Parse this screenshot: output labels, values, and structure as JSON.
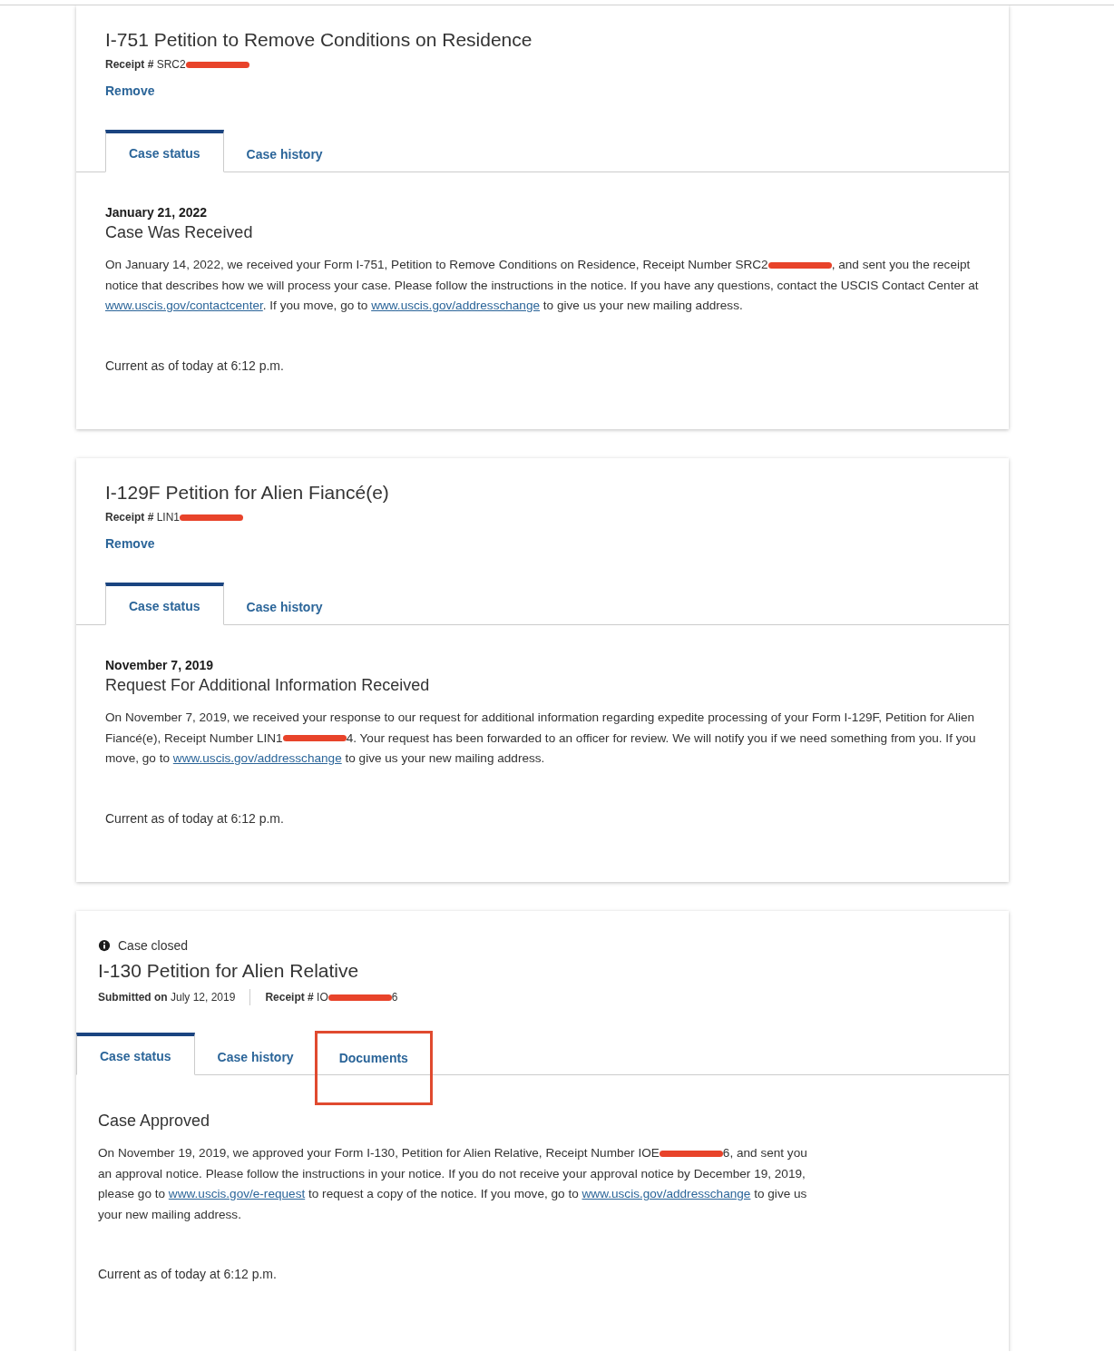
{
  "cases": [
    {
      "title": "I-751 Petition to Remove Conditions on Residence",
      "receipt": {
        "label": "Receipt #",
        "value": "SRC2",
        "redacted": true
      },
      "remove_link": "Remove",
      "tabs": [
        {
          "label": "Case status",
          "selected": true,
          "highlighted": false
        },
        {
          "label": "Case history",
          "selected": false,
          "highlighted": false
        }
      ],
      "date": "January 21, 2022",
      "status": "Case Was Received",
      "paragraph": [
        {
          "kind": "text",
          "text": "On January 14, 2022, we received your Form I-751, Petition to Remove Conditions on Residence, Receipt Number SRC2"
        },
        {
          "kind": "redaction"
        },
        {
          "kind": "text",
          "text": ", and sent you the receipt notice that describes how we will process your case. Please follow the instructions in the notice. If you have any questions, contact the USCIS Contact Center at "
        },
        {
          "kind": "link",
          "text": "www.uscis.gov/contactcenter"
        },
        {
          "kind": "text",
          "text": ". If you move, go to "
        },
        {
          "kind": "link",
          "text": "www.uscis.gov/addresschange"
        },
        {
          "kind": "text",
          "text": " to give us your new mailing address."
        }
      ],
      "current": "Current as of today at 6:12 p.m."
    },
    {
      "title": "I-129F Petition for Alien Fiancé(e)",
      "receipt": {
        "label": "Receipt #",
        "value": "LIN1",
        "redacted": true
      },
      "remove_link": "Remove",
      "tabs": [
        {
          "label": "Case status",
          "selected": true,
          "highlighted": false
        },
        {
          "label": "Case history",
          "selected": false,
          "highlighted": false
        }
      ],
      "date": "November 7, 2019",
      "status": "Request For Additional Information Received",
      "paragraph": [
        {
          "kind": "text",
          "text": "On November 7, 2019, we received your response to our request for additional information regarding expedite processing of your Form I-129F, Petition for Alien Fiancé(e), Receipt Number LIN1"
        },
        {
          "kind": "redaction"
        },
        {
          "kind": "text",
          "text": "4. Your request has been forwarded to an officer for review. We will notify you if we need something from you. If you move, go to "
        },
        {
          "kind": "link",
          "text": "www.uscis.gov/addresschange"
        },
        {
          "kind": "text",
          "text": " to give us your new mailing address."
        }
      ],
      "current": "Current as of today at 6:12 p.m."
    },
    {
      "closed_note": "Case closed",
      "title": "I-130 Petition for Alien Relative",
      "submitted": {
        "label": "Submitted on",
        "value": "July 12, 2019"
      },
      "receipt": {
        "label": "Receipt #",
        "value": "IO",
        "redacted": true,
        "suffix": "6"
      },
      "tabs": [
        {
          "label": "Case status",
          "selected": true,
          "highlighted": false
        },
        {
          "label": "Case history",
          "selected": false,
          "highlighted": false
        },
        {
          "label": "Documents",
          "selected": false,
          "highlighted": true
        }
      ],
      "status": "Case Approved",
      "paragraph": [
        {
          "kind": "text",
          "text": "On November 19, 2019, we approved your Form I-130, Petition for Alien Relative, Receipt Number IOE"
        },
        {
          "kind": "redaction"
        },
        {
          "kind": "text",
          "text": "6, and sent you an approval notice. Please follow the instructions in your notice. If you do not receive your approval notice by December 19, 2019, please go to "
        },
        {
          "kind": "link",
          "text": "www.uscis.gov/e-request"
        },
        {
          "kind": "text",
          "text": " to request a copy of the notice. If you move, go to "
        },
        {
          "kind": "link",
          "text": "www.uscis.gov/addresschange"
        },
        {
          "kind": "text",
          "text": " to give us your new mailing address."
        }
      ],
      "current": "Current as of today at 6:12 p.m."
    }
  ]
}
